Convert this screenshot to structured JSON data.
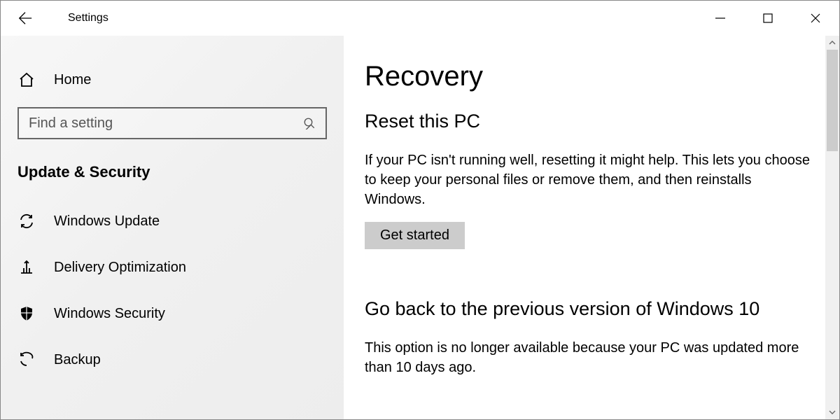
{
  "window": {
    "title": "Settings"
  },
  "sidebar": {
    "home_label": "Home",
    "search_placeholder": "Find a setting",
    "category_label": "Update & Security",
    "items": [
      {
        "label": "Windows Update"
      },
      {
        "label": "Delivery Optimization"
      },
      {
        "label": "Windows Security"
      },
      {
        "label": "Backup"
      }
    ]
  },
  "main": {
    "page_title": "Recovery",
    "sections": [
      {
        "title": "Reset this PC",
        "body": "If your PC isn't running well, resetting it might help. This lets you choose to keep your personal files or remove them, and then reinstalls Windows.",
        "button_label": "Get started"
      },
      {
        "title": "Go back to the previous version of Windows 10",
        "body": "This option is no longer available because your PC was updated more than 10 days ago."
      }
    ]
  }
}
